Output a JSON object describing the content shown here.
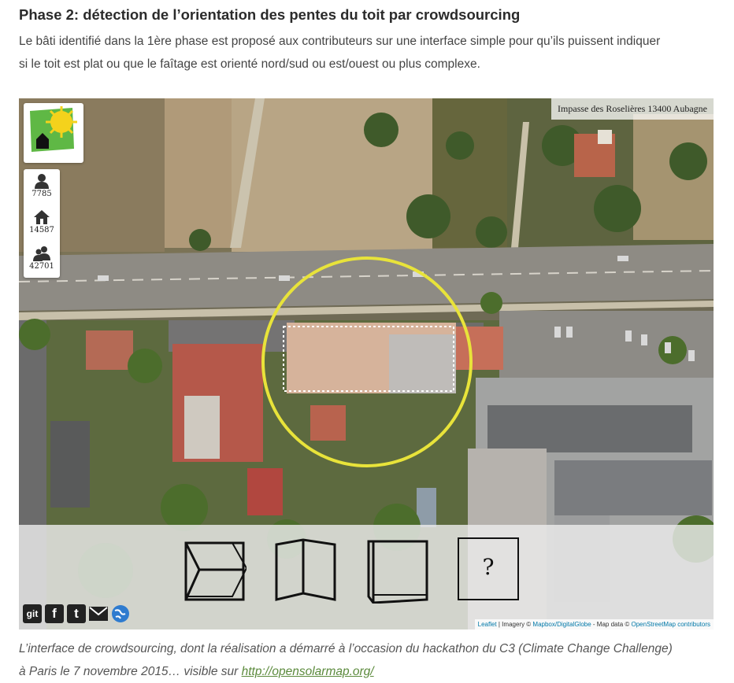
{
  "heading": "Phase 2: détection de l’orientation des pentes du toit par crowdsourcing",
  "intro": {
    "line1": "Le bâti identifié dans la 1ère phase est proposé aux contributeurs sur une interface simple pour qu’ils puissent indiquer",
    "line2": "si le toit est plat ou que le faîtage est orienté nord/sud ou est/ouest ou plus complexe."
  },
  "map": {
    "address": "Impasse des Roselières 13400 Aubagne",
    "stats": [
      {
        "icon": "user-icon",
        "value": "7785"
      },
      {
        "icon": "house-icon",
        "value": "14587"
      },
      {
        "icon": "users-icon",
        "value": "42701"
      }
    ],
    "choices": [
      {
        "name": "roof-choice-east-west",
        "icon": "box-east-west-icon"
      },
      {
        "name": "roof-choice-north-south",
        "icon": "box-north-south-icon"
      },
      {
        "name": "roof-choice-flat",
        "icon": "box-flat-icon"
      },
      {
        "name": "roof-choice-unknown",
        "label": "?"
      }
    ],
    "social": [
      {
        "name": "git-button",
        "label": "git",
        "color": "#222222"
      },
      {
        "name": "facebook-button",
        "label": "f",
        "color": "#222222"
      },
      {
        "name": "tumblr-button",
        "label": "t",
        "color": "#222222"
      },
      {
        "name": "email-button",
        "icon": "mail-icon",
        "color": "#222222"
      },
      {
        "name": "share-button",
        "icon": "globe-icon",
        "color": "#2e7bcf"
      }
    ],
    "attribution": {
      "leaflet": "Leaflet",
      "imagery_prefix": " | Imagery © ",
      "imagery_link": "Mapbox/DigitalGlobe",
      "data_prefix": " - Map data © ",
      "data_link": "OpenStreetMap contributors"
    },
    "highlight_color": "#e8e33a"
  },
  "caption": {
    "line1": "L’interface de crowdsourcing, dont la réalisation a démarré à l’occasion du hackathon du C3 (Climate Change Challenge)",
    "line2_text": "à Paris le 7 novembre 2015… visible sur ",
    "link": "http://opensolarmap.org/"
  }
}
